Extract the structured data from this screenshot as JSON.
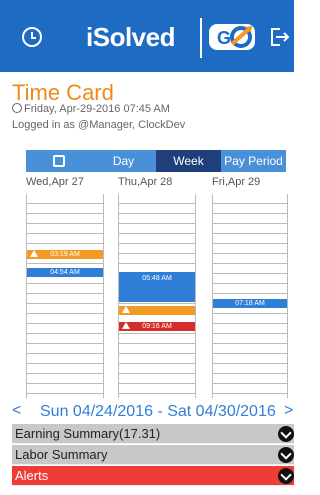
{
  "header": {
    "brand": "iSolved",
    "logo_text": "GO",
    "accent_color": "#1e6bc4"
  },
  "page": {
    "title": "Time Card",
    "date_line": "Friday, Apr-29-2016 07:45 AM",
    "login_line": "Logged in as @Manager, ClockDev"
  },
  "tabs": [
    {
      "label": ""
    },
    {
      "label": "Day"
    },
    {
      "label": "Week"
    },
    {
      "label": "Pay Period"
    }
  ],
  "days": [
    {
      "label": "Wed,Apr 27",
      "events": [
        {
          "text": "03:19 AM",
          "color": "orange",
          "warn": true
        },
        {
          "text": "04:54 AM",
          "color": "blue",
          "warn": false
        }
      ]
    },
    {
      "label": "Thu,Apr 28",
      "events": [
        {
          "text": "05:48 AM",
          "color": "blue",
          "warn": false
        },
        {
          "text": "",
          "color": "orange",
          "warn": true
        },
        {
          "text": "09:16 AM",
          "color": "red",
          "warn": true
        }
      ]
    },
    {
      "label": "Fri,Apr 29",
      "events": [
        {
          "text": "07:18 AM",
          "color": "blue",
          "warn": false
        }
      ]
    }
  ],
  "week_nav": {
    "prev": "<",
    "range": "Sun 04/24/2016 - Sat 04/30/2016",
    "next": ">"
  },
  "sections": [
    {
      "label": "Earning Summary(17.31)"
    },
    {
      "label": "Labor Summary"
    },
    {
      "label": "Alerts"
    }
  ]
}
